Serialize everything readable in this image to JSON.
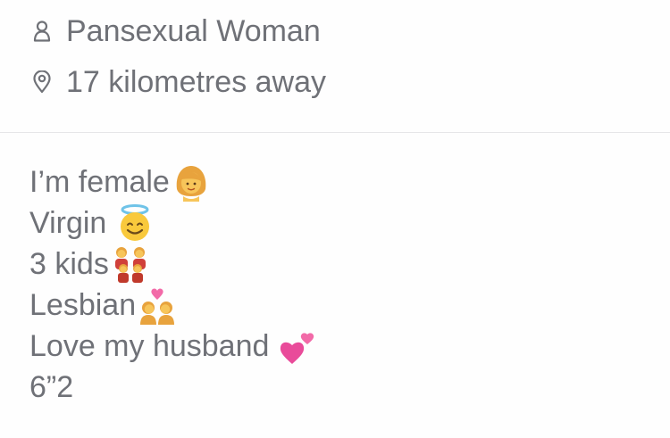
{
  "profile": {
    "orientation": {
      "icon": "person-outline-icon",
      "text": "Pansexual Woman"
    },
    "distance": {
      "icon": "location-pin-icon",
      "text": "17 kilometres away"
    },
    "bio_lines": [
      {
        "text": "I’m female",
        "emoji": "woman-emoji"
      },
      {
        "text": "Virgin",
        "emoji": "smiling-face-with-halo-emoji"
      },
      {
        "text": "3 kids",
        "emoji": "family-emoji"
      },
      {
        "text": "Lesbian",
        "emoji": "couple-with-heart-women-emoji"
      },
      {
        "text": "Love my husband",
        "emoji": "two-hearts-emoji"
      },
      {
        "text": "6”2"
      }
    ]
  },
  "colors": {
    "text": "#6f7177",
    "divider": "#e6e6e8",
    "background": "#fefefe"
  }
}
